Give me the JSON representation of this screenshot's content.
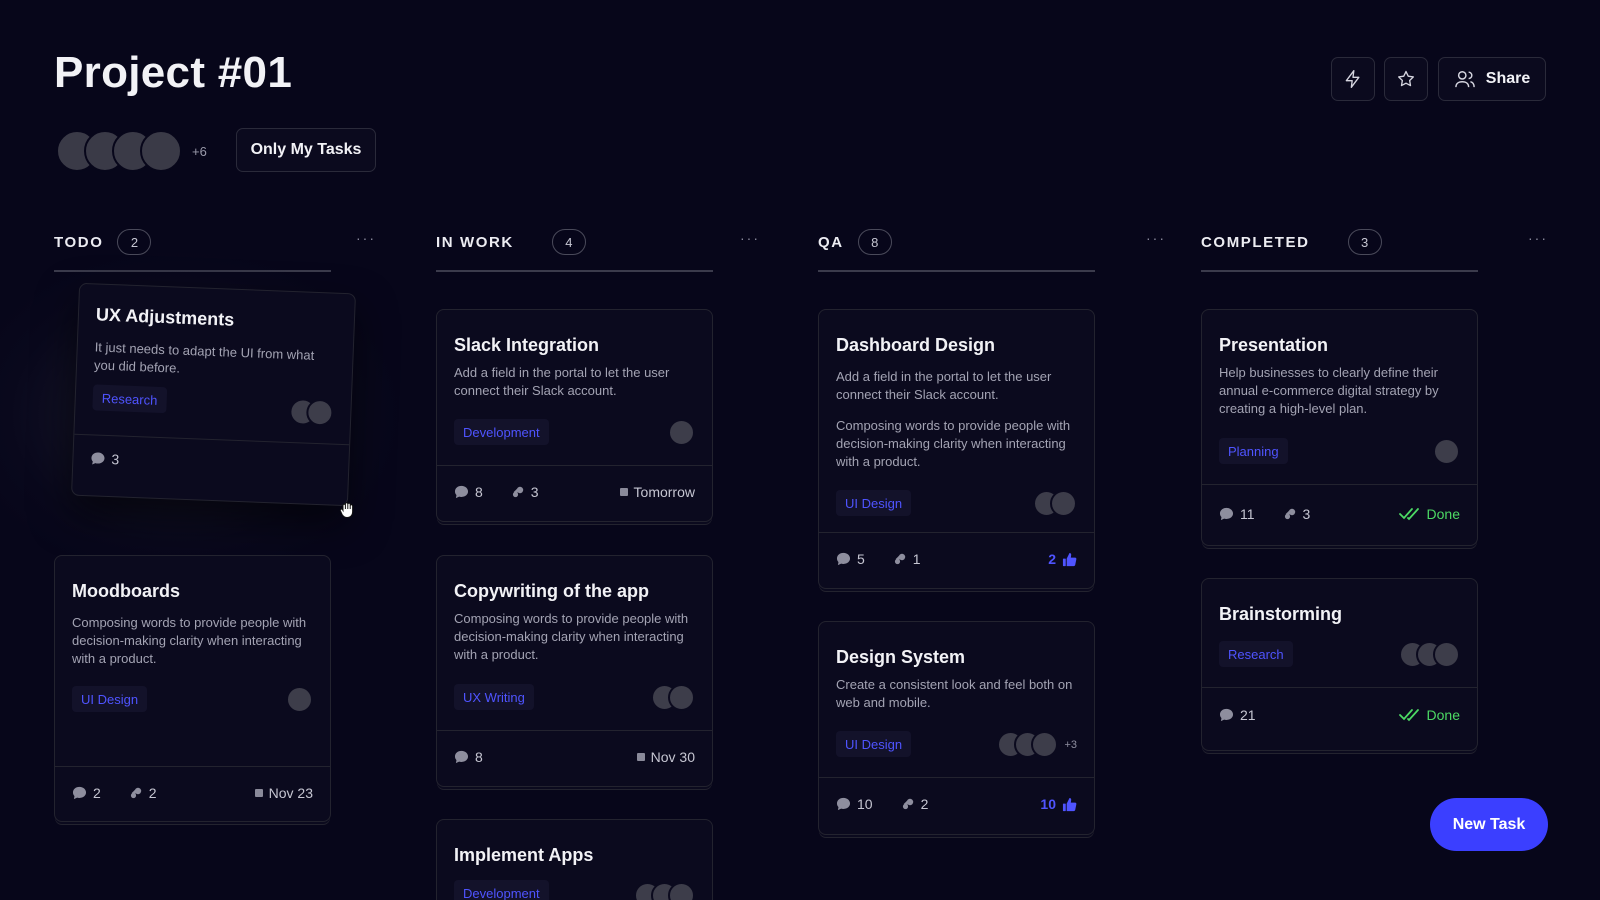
{
  "header": {
    "title": "Project #01",
    "extra_members": "+6",
    "only_my_tasks": "Only My Tasks",
    "share": "Share"
  },
  "icons": {
    "bolt": "bolt-icon",
    "star": "star-icon",
    "share": "users-icon",
    "comment": "comment-icon",
    "attachment": "paperclip-icon",
    "date": "calendar-icon",
    "like": "thumbs-up-icon",
    "done": "double-check-icon",
    "cursor": "grab-hand-icon"
  },
  "colors": {
    "background": "#07061a",
    "accent": "#3b3fff",
    "tag_text": "#4f54ff",
    "done": "#4cd964"
  },
  "columns": [
    {
      "name": "TODO",
      "count": "2",
      "more": "···",
      "cards": [
        {
          "title": "UX Adjustments",
          "desc": "It just needs to adapt the UI from what you did before.",
          "tag": "Research",
          "comments": "3",
          "dragging": true
        },
        {
          "title": "Moodboards",
          "desc": "Composing words to provide people with decision-making clarity when interacting with a product.",
          "tag": "UI Design",
          "comments": "2",
          "attachments": "2",
          "date": "Nov 23"
        }
      ]
    },
    {
      "name": "IN WORK",
      "count": "4",
      "more": "···",
      "cards": [
        {
          "title": "Slack Integration",
          "desc": "Add a field in the portal to let the user connect their Slack account.",
          "tag": "Development",
          "comments": "8",
          "attachments": "3",
          "date": "Tomorrow"
        },
        {
          "title": "Copywriting of the app",
          "desc": "Composing words to provide people with decision-making clarity when interacting with a product.",
          "tag": "UX Writing",
          "comments": "8",
          "date": "Nov 30"
        },
        {
          "title": "Implement Apps",
          "tag": "Development"
        }
      ]
    },
    {
      "name": "QA",
      "count": "8",
      "more": "···",
      "cards": [
        {
          "title": "Dashboard Design",
          "desc": "Add a field in the portal to let the user connect their Slack account.",
          "desc2": "Composing words to provide people with decision-making clarity when interacting with a product.",
          "tag": "UI Design",
          "comments": "5",
          "attachments": "1",
          "likes": "2"
        },
        {
          "title": "Design System",
          "desc": "Create a consistent look and feel both on web and mobile.",
          "tag": "UI Design",
          "extra_members": "+3",
          "comments": "10",
          "attachments": "2",
          "likes": "10"
        }
      ]
    },
    {
      "name": "COMPLETED",
      "count": "3",
      "more": "···",
      "cards": [
        {
          "title": "Presentation",
          "desc": "Help businesses to clearly define their annual e-commerce digital strategy by creating a high-level plan.",
          "tag": "Planning",
          "comments": "11",
          "attachments": "3",
          "status": "Done"
        },
        {
          "title": "Brainstorming",
          "tag": "Research",
          "comments": "21",
          "status": "Done"
        }
      ]
    }
  ],
  "new_task": "New Task"
}
